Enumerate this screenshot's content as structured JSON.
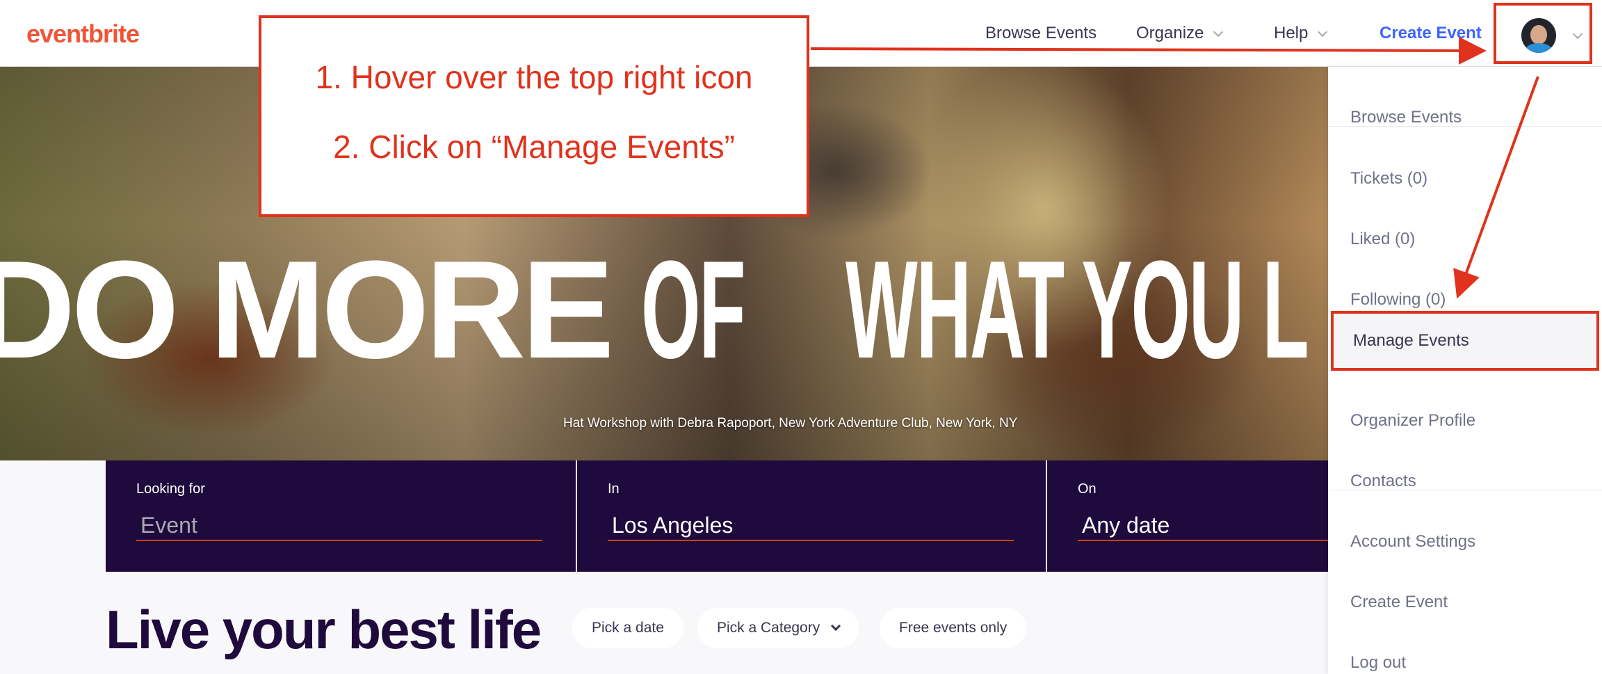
{
  "app": {
    "logo": "eventbrite"
  },
  "nav": {
    "browse_events": "Browse Events",
    "organize": "Organize",
    "help": "Help",
    "create_event": "Create Event"
  },
  "hero": {
    "headline_1": "DO MORE",
    "headline_2": "OF",
    "headline_3": "WHAT YOU L",
    "caption": "Hat Workshop with Debra Rapoport, New York Adventure Club, New York, NY"
  },
  "callout": {
    "step1": "1. Hover over the top right icon",
    "step2": "2. Click on “Manage Events”"
  },
  "search": {
    "looking_for_label": "Looking for",
    "looking_for_placeholder": "Event",
    "in_label": "In",
    "in_value": "Los Angeles",
    "on_label": "On",
    "on_value": "Any date"
  },
  "main": {
    "title": "Live your best life",
    "filters": {
      "pick_date": "Pick a date",
      "pick_category": "Pick a Category",
      "free_only": "Free events only"
    }
  },
  "dropdown": {
    "items": [
      "Browse Events",
      "Tickets (0)",
      "Liked (0)",
      "Following (0)",
      "Manage Events",
      "Organizer Profile",
      "Contacts",
      "Account Settings",
      "Create Event",
      "Log out"
    ]
  },
  "colors": {
    "brand_orange": "#f05537",
    "annotation_red": "#e0321c",
    "search_bg": "#1e0a3c",
    "create_link_blue": "#3d64ff"
  },
  "icons": [
    "avatar-icon",
    "chevron-down-icon"
  ]
}
